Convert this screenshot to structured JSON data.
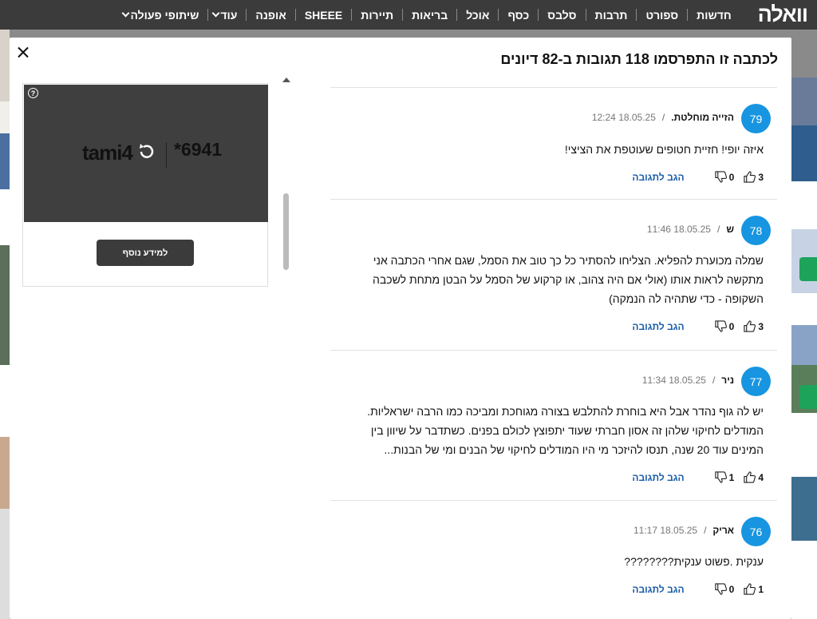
{
  "site": {
    "logo": "וואלה"
  },
  "nav": {
    "items": [
      {
        "label": "חדשות",
        "dropdown": false
      },
      {
        "label": "ספורט",
        "dropdown": false
      },
      {
        "label": "תרבות",
        "dropdown": false
      },
      {
        "label": "סלבס",
        "dropdown": false
      },
      {
        "label": "כסף",
        "dropdown": false
      },
      {
        "label": "אוכל",
        "dropdown": false
      },
      {
        "label": "בריאות",
        "dropdown": false
      },
      {
        "label": "תיירות",
        "dropdown": false
      },
      {
        "label": "SHEEE",
        "dropdown": false
      },
      {
        "label": "אופנה",
        "dropdown": false
      },
      {
        "label": "עוד",
        "dropdown": true
      },
      {
        "label": "שיתופי פעולה",
        "dropdown": true
      }
    ]
  },
  "modal": {
    "title": "לכתבה זו התפרסמו 118 תגובות ב-82 דיונים",
    "close_icon": "close-icon"
  },
  "ad": {
    "brand": "tami4",
    "code": "*6941",
    "more_label": "למידע נוסף",
    "help_glyph": "?"
  },
  "comments": [
    {
      "number": "79",
      "author": "הזייה מוחלטת.",
      "date": "18.05.25 12:24",
      "text": "איזה יופי! חזיית חטופים שעוטפת את הציצי!",
      "likes": "3",
      "dislikes": "0",
      "reply_label": "הגב לתגובה"
    },
    {
      "number": "78",
      "author": "ש",
      "date": "18.05.25 11:46",
      "text": "שמלה מכוערת להפליא. הצליחו להסתיר כל כך טוב את הסמל, שגם אחרי הכתבה אני מתקשה לראות אותו (אולי אם היה צהוב, או קרקוע של הסמל על הבטן מתחת לשכבה השקופה - כדי שתהיה לה הנמקה)",
      "likes": "3",
      "dislikes": "0",
      "reply_label": "הגב לתגובה"
    },
    {
      "number": "77",
      "author": "ניר",
      "date": "18.05.25 11:34",
      "text": "יש לה גוף נהדר אבל היא בוחרת להתלבש בצורה מגוחכת ומביכה כמו הרבה ישראליות. המודלים לחיקוי שלהן זה אסון חברתי שעוד יתפוצץ לכולם בפנים. כשתדבר על שיוון בין המינים עוד 20 שנה, תנסו להיזכר מי היו המודלים לחיקוי של הבנים ומי של הבנות...",
      "likes": "4",
      "dislikes": "1",
      "reply_label": "הגב לתגובה"
    },
    {
      "number": "76",
      "author": "אריק",
      "date": "18.05.25 11:17",
      "text": "ענקית .פשוט ענקית????????",
      "likes": "1",
      "dislikes": "0",
      "reply_label": "הגב לתגובה"
    }
  ]
}
